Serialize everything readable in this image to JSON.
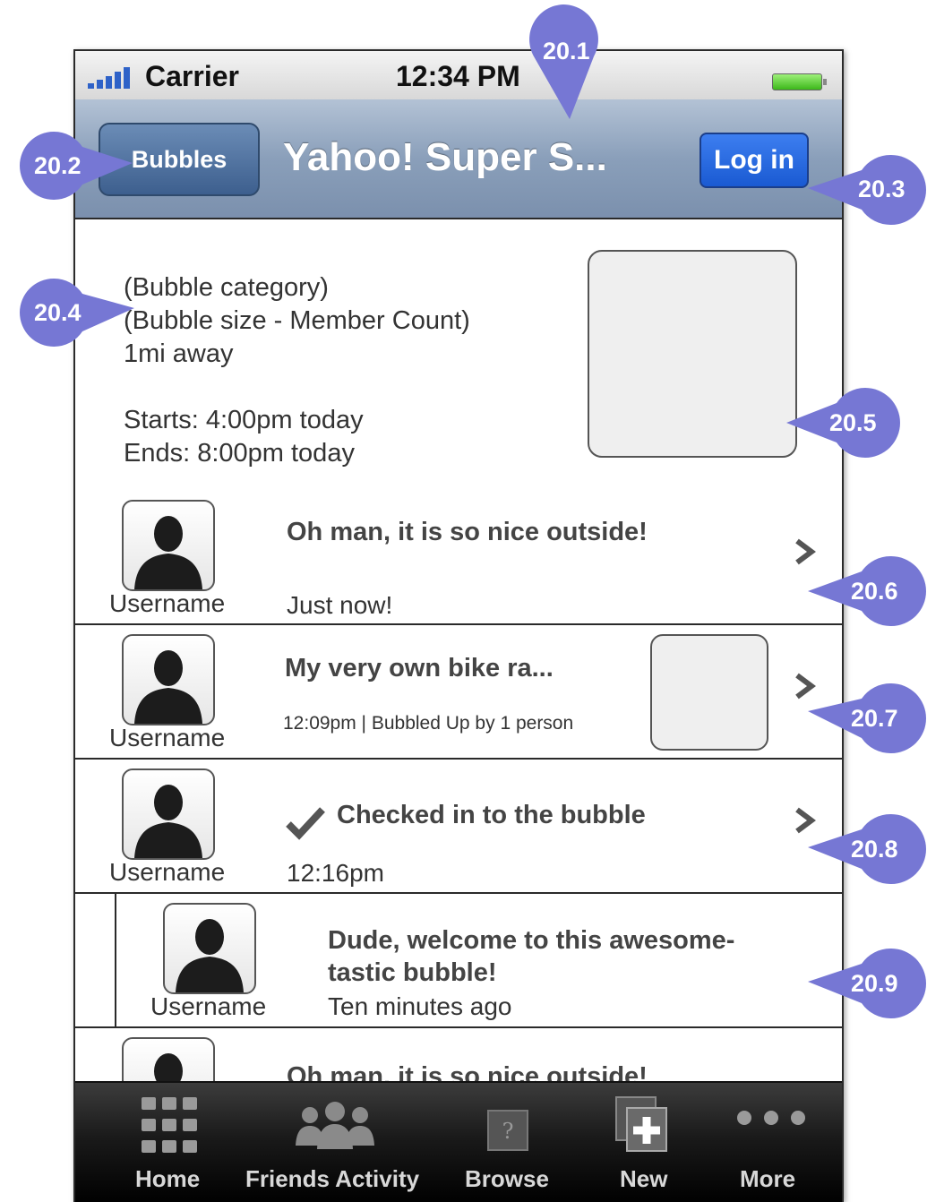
{
  "status_bar": {
    "carrier": "Carrier",
    "time": "12:34 PM"
  },
  "nav": {
    "back_label": "Bubbles",
    "title": "Yahoo! Super S...",
    "login_label": "Log in"
  },
  "bubble_info": {
    "category": "(Bubble category)",
    "size": "(Bubble size - Member Count)",
    "distance": "1mi away",
    "starts": "Starts: 4:00pm today",
    "ends": "Ends: 8:00pm today"
  },
  "feed": [
    {
      "username": "Username",
      "title": "Oh man, it is so nice outside!",
      "meta": "Just now!"
    },
    {
      "username": "Username",
      "title": "My very own bike ra...",
      "meta": "12:09pm | Bubbled Up by 1 person"
    },
    {
      "username": "Username",
      "title": "Checked in to the bubble",
      "meta": "12:16pm"
    },
    {
      "username": "Username",
      "title_line1": "Dude, welcome to this awesome-",
      "title_line2": "tastic bubble!",
      "meta": "Ten minutes ago"
    },
    {
      "title": "Oh man, it is so nice outside!"
    }
  ],
  "tabs": [
    {
      "label": "Home",
      "icon": "grid-icon"
    },
    {
      "label": "Friends Activity",
      "icon": "people-icon"
    },
    {
      "label": "Browse",
      "icon": "question-box-icon"
    },
    {
      "label": "New",
      "icon": "plus-box-icon"
    },
    {
      "label": "More",
      "icon": "ellipsis-icon"
    }
  ],
  "callouts": [
    "20.1",
    "20.2",
    "20.3",
    "20.4",
    "20.5",
    "20.6",
    "20.7",
    "20.8",
    "20.9"
  ],
  "colors": {
    "callout": "#7677d4",
    "nav_bar": "#8a9fba",
    "login_button": "#1a5ad2"
  }
}
